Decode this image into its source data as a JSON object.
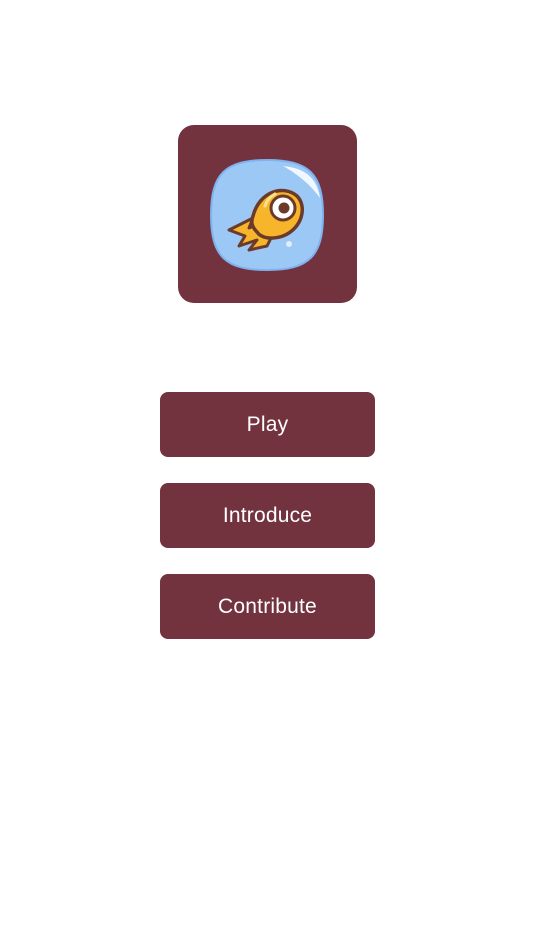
{
  "app": {
    "logo_icon": "comet-icon",
    "accent_color": "#72333f"
  },
  "menu": {
    "play_label": "Play",
    "introduce_label": "Introduce",
    "contribute_label": "Contribute"
  }
}
